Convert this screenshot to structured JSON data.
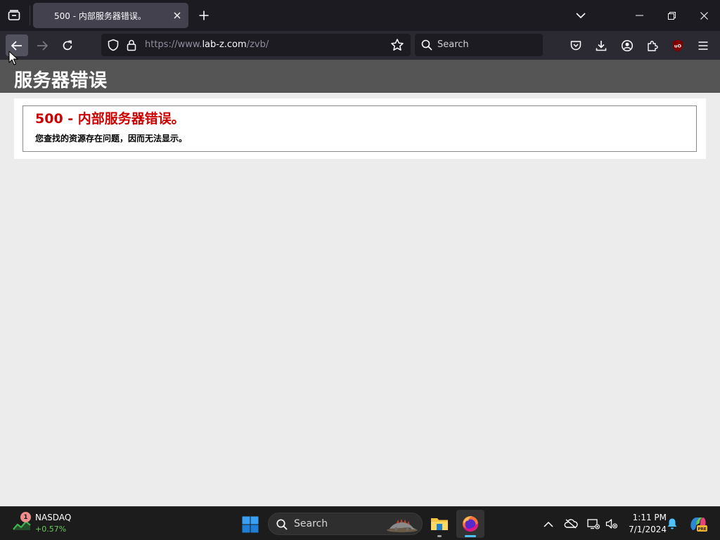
{
  "browser": {
    "tab": {
      "title": "500 - 内部服务器错误。"
    },
    "url": {
      "prefix": "https://www.",
      "host": "lab-z.com",
      "path": "/zvb/"
    },
    "search_placeholder": "Search",
    "addon_badge": "uO"
  },
  "page": {
    "header": "服务器错误",
    "error_title": "500 - 内部服务器错误。",
    "error_description": "您查找的资源存在问题，因而无法显示。"
  },
  "taskbar": {
    "widget": {
      "name": "NASDAQ",
      "change": "+0.57%",
      "badge": "1"
    },
    "search_label": "Search",
    "clock": {
      "time": "1:11 PM",
      "date": "7/1/2024"
    },
    "copilot_badge": "PRE"
  },
  "colors": {
    "error_red": "#cc0000",
    "header_gray": "#555555",
    "page_background": "#ececec",
    "stock_green": "#6ccb5f"
  }
}
